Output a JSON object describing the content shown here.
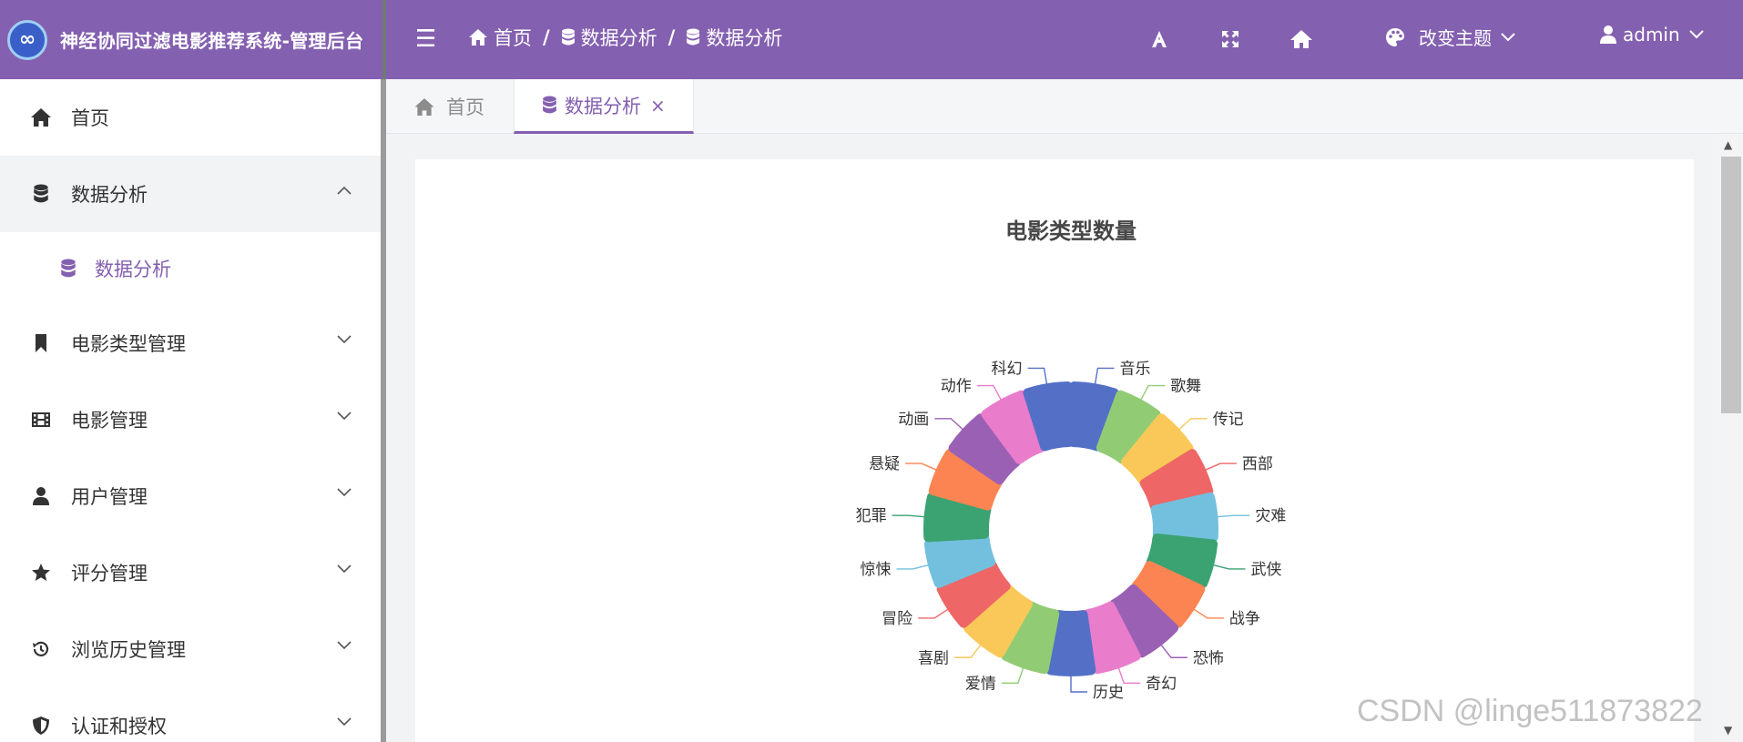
{
  "header": {
    "app_title": "神经协同过滤电影推荐系统-管理后台",
    "breadcrumb": [
      "首页",
      "数据分析",
      "数据分析"
    ],
    "theme_label": "改变主题",
    "user_label": "admin",
    "bg_color": "#8460b0"
  },
  "sidebar": {
    "items": [
      {
        "label": "首页",
        "icon": "home-icon"
      },
      {
        "label": "数据分析",
        "icon": "database-icon",
        "expanded": true,
        "children": [
          {
            "label": "数据分析",
            "icon": "database-icon"
          }
        ]
      },
      {
        "label": "电影类型管理",
        "icon": "bookmark-icon"
      },
      {
        "label": "电影管理",
        "icon": "film-icon"
      },
      {
        "label": "用户管理",
        "icon": "user-icon"
      },
      {
        "label": "评分管理",
        "icon": "star-icon"
      },
      {
        "label": "浏览历史管理",
        "icon": "history-icon"
      },
      {
        "label": "认证和授权",
        "icon": "shield-icon"
      }
    ]
  },
  "tabs": [
    {
      "label": "首页",
      "active": false
    },
    {
      "label": "数据分析",
      "active": true,
      "close": "×"
    }
  ],
  "chart_data": {
    "type": "pie",
    "variant": "rose-donut",
    "title": "电影类型数量",
    "categories": [
      "音乐",
      "歌舞",
      "传记",
      "西部",
      "灾难",
      "武侠",
      "战争",
      "恐怖",
      "奇幻",
      "历史",
      "爱情",
      "喜剧",
      "冒险",
      "惊悚",
      "犯罪",
      "悬疑",
      "动画",
      "动作",
      "科幻"
    ],
    "values": [
      1,
      1,
      1,
      1,
      1,
      1,
      1,
      1,
      1,
      1,
      1,
      1,
      1,
      1,
      1,
      1,
      1,
      1,
      1
    ],
    "colors": [
      "#5470c6",
      "#91cc75",
      "#fac858",
      "#ee6666",
      "#73c0de",
      "#3ba272",
      "#fc8452",
      "#9a60b4",
      "#ea7ccc",
      "#5470c6",
      "#91cc75",
      "#fac858",
      "#ee6666",
      "#73c0de",
      "#3ba272",
      "#fc8452",
      "#9a60b4",
      "#ea7ccc",
      "#5470c6"
    ],
    "legend": "none"
  },
  "watermark": "CSDN @linge511873822"
}
